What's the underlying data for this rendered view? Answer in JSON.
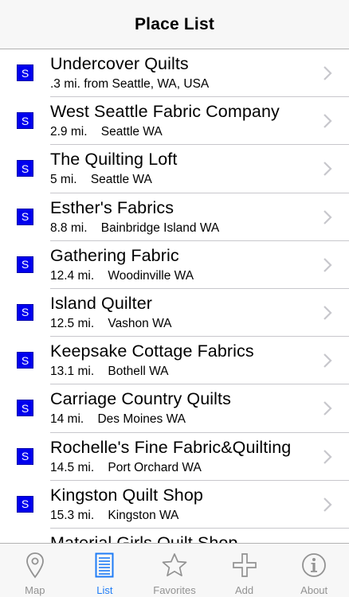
{
  "header": {
    "title": "Place List"
  },
  "places": [
    {
      "badge": "S",
      "name": "Undercover Quilts",
      "distance": ".3 mi. from Seattle, WA, USA",
      "location": ""
    },
    {
      "badge": "S",
      "name": "West Seattle Fabric Company",
      "distance": "2.9 mi.",
      "location": "Seattle WA"
    },
    {
      "badge": "S",
      "name": "The Quilting Loft",
      "distance": "5 mi.",
      "location": "Seattle WA"
    },
    {
      "badge": "S",
      "name": "Esther's Fabrics",
      "distance": "8.8 mi.",
      "location": "Bainbridge Island WA"
    },
    {
      "badge": "S",
      "name": "Gathering Fabric",
      "distance": "12.4 mi.",
      "location": "Woodinville WA"
    },
    {
      "badge": "S",
      "name": "Island Quilter",
      "distance": "12.5 mi.",
      "location": "Vashon WA"
    },
    {
      "badge": "S",
      "name": "Keepsake Cottage Fabrics",
      "distance": "13.1 mi.",
      "location": "Bothell WA"
    },
    {
      "badge": "S",
      "name": "Carriage Country Quilts",
      "distance": "14 mi.",
      "location": "Des Moines WA"
    },
    {
      "badge": "S",
      "name": "Rochelle's Fine Fabric&Quilting",
      "distance": "14.5 mi.",
      "location": "Port Orchard WA"
    },
    {
      "badge": "S",
      "name": "Kingston Quilt Shop",
      "distance": "15.3 mi.",
      "location": "Kingston WA"
    },
    {
      "badge": "",
      "name": "Material Girls Quilt Shop",
      "distance": "",
      "location": ""
    }
  ],
  "tabs": [
    {
      "label": "Map",
      "icon": "map-pin-icon",
      "active": false
    },
    {
      "label": "List",
      "icon": "list-icon",
      "active": true
    },
    {
      "label": "Favorites",
      "icon": "star-icon",
      "active": false
    },
    {
      "label": "Add",
      "icon": "plus-icon",
      "active": false
    },
    {
      "label": "About",
      "icon": "info-icon",
      "active": false
    }
  ],
  "colors": {
    "accent": "#1f7cf6",
    "badge": "#0000ee",
    "inactive": "#929292"
  }
}
